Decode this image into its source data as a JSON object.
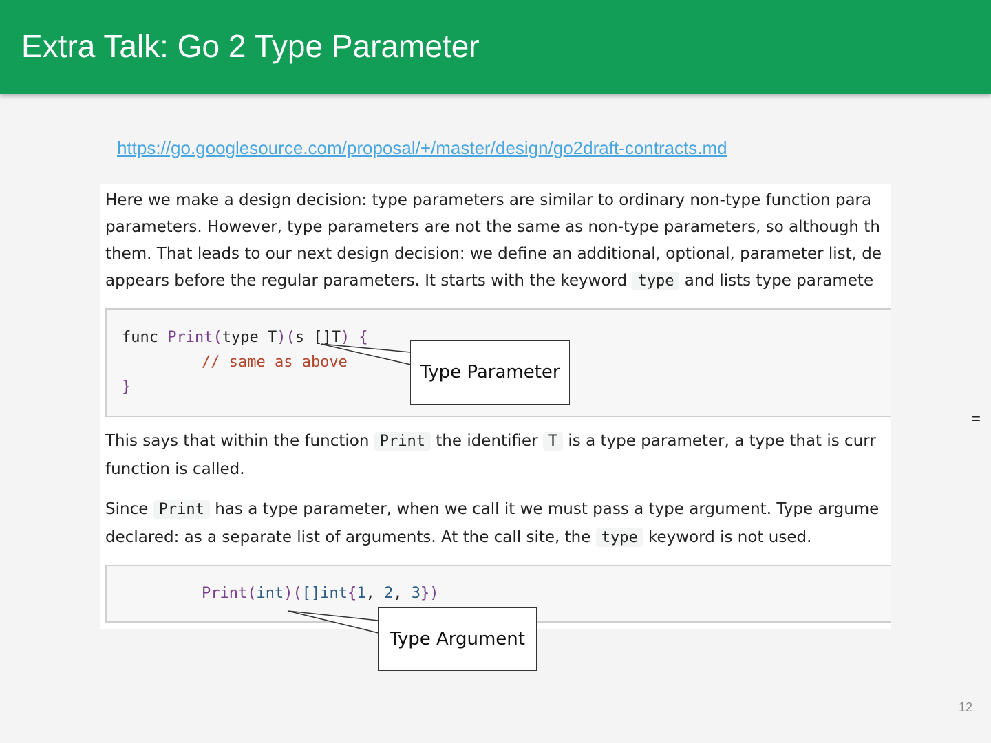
{
  "slide": {
    "title": "Extra Talk: Go 2 Type Parameter",
    "link": "https://go.googlesource.com/proposal/+/master/design/go2draft-contracts.md",
    "page_number": "12",
    "side_mark": "="
  },
  "screenshot": {
    "para1": [
      "Here we make a design decision: type parameters are similar to ordinary non-type function para",
      "parameters. However, type parameters are not the same as non-type parameters, so although th",
      "them. That leads to our next design decision: we define an additional, optional, parameter list, de"
    ],
    "para1_line4_before": "appears before the regular parameters. It starts with the keyword",
    "para1_line4_code": "type",
    "para1_line4_after": "and lists type paramete",
    "code1": {
      "line1": {
        "func": "func",
        "name": "Print",
        "open1": "(",
        "type_kw": "type",
        "t": " T",
        "close1": ")(",
        "s": "s",
        "slice": " []T",
        "close2": ") {"
      },
      "line2": "// same as above",
      "line3": "}"
    },
    "para2": {
      "before": "This says that within the function",
      "code1": "Print",
      "mid": "the identifier",
      "code2": "T",
      "after": "is a type parameter, a type that is curr",
      "line2": "function is called."
    },
    "para3": {
      "before": "Since",
      "code1": "Print",
      "after": "has a type parameter, when we call it we must pass a type argument. Type argume",
      "line2_before": "declared: as a separate list of arguments. At the call site, the",
      "line2_code": "type",
      "line2_after": "keyword is not used."
    },
    "code2": {
      "name": "Print",
      "open1": "(",
      "arg": "int",
      "close1": ")(",
      "slice": "[]int",
      "brace_open": "{",
      "n1": "1",
      "comma1": ", ",
      "n2": "2",
      "comma2": ", ",
      "n3": "3",
      "brace_close": "})"
    }
  },
  "callouts": {
    "type_parameter": "Type Parameter",
    "type_argument": "Type Argument"
  }
}
